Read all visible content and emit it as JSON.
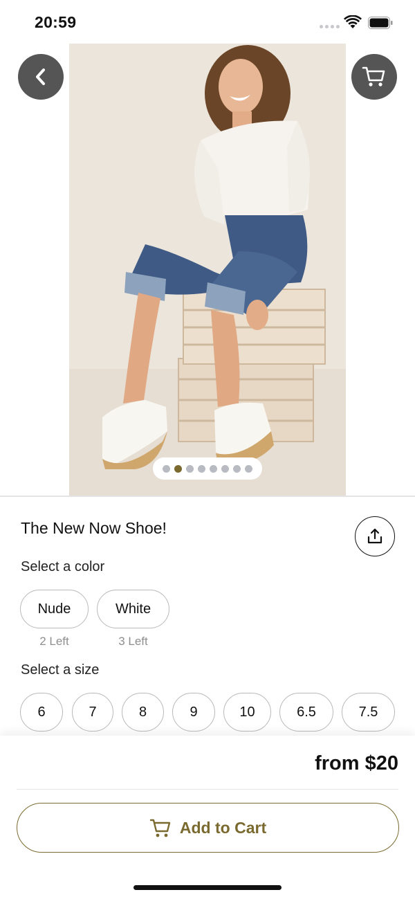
{
  "status_bar": {
    "time": "20:59",
    "icons": [
      "signal-dots-icon",
      "wifi-icon",
      "battery-icon"
    ]
  },
  "navigation": {
    "back_icon": "chevron-left-icon",
    "cart_icon": "cart-icon"
  },
  "gallery": {
    "image_description_icon": "product-photo",
    "page_count": 8,
    "active_page": 2
  },
  "product": {
    "title": "The New Now Shoe!",
    "share_icon": "share-icon"
  },
  "color_section": {
    "label": "Select a color",
    "options": [
      {
        "name": "Nude",
        "stock": "2 Left"
      },
      {
        "name": "White",
        "stock": "3 Left"
      }
    ]
  },
  "size_section": {
    "label": "Select a size",
    "options": [
      "6",
      "7",
      "8",
      "9",
      "10",
      "6.5",
      "7.5"
    ]
  },
  "purchase": {
    "price": "from $20",
    "add_to_cart": "Add to Cart",
    "accent_color": "#7a6a2f"
  }
}
